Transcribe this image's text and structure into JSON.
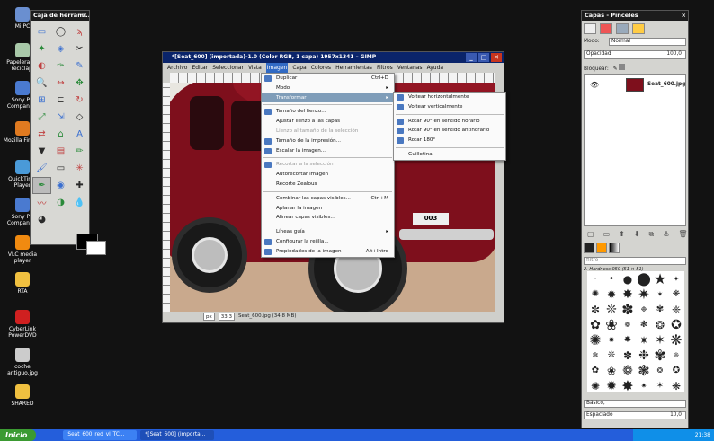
{
  "desktop": {
    "icons": [
      {
        "label": "Mi PC",
        "icon": "my-computer-icon",
        "color": "#6a8fd0"
      },
      {
        "label": "Papelera de reciclaje",
        "icon": "recycle-bin-icon",
        "color": "#a8c8a8"
      },
      {
        "label": "Sony PC Companion",
        "icon": "sony-pc-companion-icon",
        "color": "#4a7ad0"
      },
      {
        "label": "Mozilla Firefox",
        "icon": "firefox-icon",
        "color": "#e07a20"
      },
      {
        "label": "QuickTime Player",
        "icon": "quicktime-icon",
        "color": "#4a9ad8"
      },
      {
        "label": "Sony PC Companion",
        "icon": "sony-pc-companion-icon",
        "color": "#4a7ad0"
      },
      {
        "label": "VLC media player",
        "icon": "vlc-icon",
        "color": "#f08a10"
      },
      {
        "label": "RTA",
        "icon": "folder-icon",
        "color": "#f0c040"
      },
      {
        "label": "CyberLink PowerDVD",
        "icon": "powerdvd-icon",
        "color": "#d02020"
      },
      {
        "label": "coche antiguo.jpg",
        "icon": "image-file-icon",
        "color": "#cccccc"
      },
      {
        "label": "SHARED",
        "icon": "shared-folder-icon",
        "color": "#f0c040"
      }
    ]
  },
  "toolbox": {
    "title": "Caja de herrami...",
    "close": "×",
    "tools": [
      "rect-select-icon",
      "ellipse-select-icon",
      "lasso-icon",
      "fuzzy-select-icon",
      "color-select-icon",
      "scissors-icon",
      "foreground-select-icon",
      "paths-icon",
      "color-picker-icon",
      "zoom-icon",
      "measure-icon",
      "move-icon",
      "align-icon",
      "crop-icon",
      "rotate-icon",
      "scale-icon",
      "shear-icon",
      "perspective-icon",
      "flip-icon",
      "cage-icon",
      "text-icon",
      "bucket-fill-icon",
      "blend-icon",
      "pencil-icon",
      "paintbrush-icon",
      "eraser-icon",
      "airbrush-icon",
      "ink-icon",
      "clone-icon",
      "heal-icon",
      "smudge-icon",
      "dodge-icon",
      "blur-icon",
      "dodge-burn-icon"
    ],
    "tool_glyphs": [
      "▭",
      "◯",
      "ϡ",
      "✦",
      "◈",
      "✂",
      "◐",
      "✑",
      "✎",
      "🔍",
      "↔",
      "✥",
      "⊞",
      "⊏",
      "↻",
      "⤢",
      "⇲",
      "◇",
      "⇄",
      "⌂",
      "A",
      "▼",
      "▤",
      "✏",
      "🖌",
      "▭",
      "✳",
      "✒",
      "◉",
      "✚",
      "〰",
      "◑",
      "💧",
      "◕"
    ],
    "foreground_color": "#000000",
    "background_color": "#ffffff"
  },
  "gimp_window": {
    "title": "*[Seat_600] (importada)-1.0 (Color RGB, 1 capa) 1957x1341 – GIMP",
    "menus": [
      "Archivo",
      "Editar",
      "Seleccionar",
      "Vista",
      "Imagen",
      "Capa",
      "Colores",
      "Herramientas",
      "Filtros",
      "Ventanas",
      "Ayuda"
    ],
    "active_menu": "Imagen",
    "plate": "003",
    "status": {
      "unit": "px",
      "zoom": "33,3",
      "file_info": "Seat_600.jpg (34,8 MB)"
    }
  },
  "image_menu": {
    "items": [
      {
        "label": "Duplicar",
        "shortcut": "Ctrl+D",
        "disabled": false,
        "icon": "duplicate-icon"
      },
      {
        "label": "Modo",
        "shortcut": "▸",
        "disabled": false,
        "icon": ""
      },
      {
        "label": "Transformar",
        "shortcut": "▸",
        "disabled": false,
        "icon": "",
        "highlighted": true
      },
      {
        "sep": true
      },
      {
        "label": "Tamaño del lienzo...",
        "shortcut": "",
        "disabled": false,
        "icon": "canvas-size-icon"
      },
      {
        "label": "Ajustar lienzo a las capas",
        "shortcut": "",
        "disabled": false,
        "icon": ""
      },
      {
        "label": "Lienzo al tamaño de la selección",
        "shortcut": "",
        "disabled": true,
        "icon": ""
      },
      {
        "label": "Tamaño de la impresión...",
        "shortcut": "",
        "disabled": false,
        "icon": "print-size-icon"
      },
      {
        "label": "Escalar la imagen...",
        "shortcut": "",
        "disabled": false,
        "icon": "scale-image-icon"
      },
      {
        "sep": true
      },
      {
        "label": "Recortar a la selección",
        "shortcut": "",
        "disabled": true,
        "icon": "crop-icon"
      },
      {
        "label": "Autorecortar imagen",
        "shortcut": "",
        "disabled": false,
        "icon": ""
      },
      {
        "label": "Recorte Zealous",
        "shortcut": "",
        "disabled": false,
        "icon": ""
      },
      {
        "sep": true
      },
      {
        "label": "Combinar las capas visibles...",
        "shortcut": "Ctrl+M",
        "disabled": false,
        "icon": ""
      },
      {
        "label": "Aplanar la imagen",
        "shortcut": "",
        "disabled": false,
        "icon": ""
      },
      {
        "label": "Alinear capas visibles...",
        "shortcut": "",
        "disabled": false,
        "icon": ""
      },
      {
        "sep": true
      },
      {
        "label": "Líneas guía",
        "shortcut": "▸",
        "disabled": false,
        "icon": ""
      },
      {
        "label": "Configurar la rejilla...",
        "shortcut": "",
        "disabled": false,
        "icon": "grid-icon"
      },
      {
        "label": "Propiedades de la imagen",
        "shortcut": "Alt+Intro",
        "disabled": false,
        "icon": "info-icon"
      }
    ]
  },
  "transform_submenu": {
    "items": [
      {
        "label": "Voltear horizontalmente",
        "icon": "flip-horizontal-icon"
      },
      {
        "label": "Voltear verticalmente",
        "icon": "flip-vertical-icon"
      },
      {
        "sep": true
      },
      {
        "label": "Rotar 90° en sentido horario",
        "icon": "rotate-cw-icon"
      },
      {
        "label": "Rotar 90° en sentido antihorario",
        "icon": "rotate-ccw-icon"
      },
      {
        "label": "Rotar 180°",
        "icon": "rotate-180-icon"
      },
      {
        "sep": true
      },
      {
        "label": "Guillotina",
        "icon": ""
      }
    ]
  },
  "layers_panel": {
    "title": "Capas - Pinceles",
    "close": "×",
    "mode_label": "Modo:",
    "mode_value": "Normal",
    "opacity_label": "Opacidad",
    "opacity_value": "100,0",
    "lock_label": "Bloquear:",
    "layer_name": "Seat_600.jpg",
    "brush_filter": "filtro",
    "brush_name": "2. Hardness 050 (51 × 51)",
    "brush_mode": "Básico,",
    "spacing_label": "Espaciado",
    "spacing_value": "10,0"
  },
  "taskbar": {
    "start_label": "Inicio",
    "tasks": [
      "Seat_600_red_vl_TC...",
      "*[Seat_600] (importa..."
    ],
    "clock": "21:38"
  }
}
